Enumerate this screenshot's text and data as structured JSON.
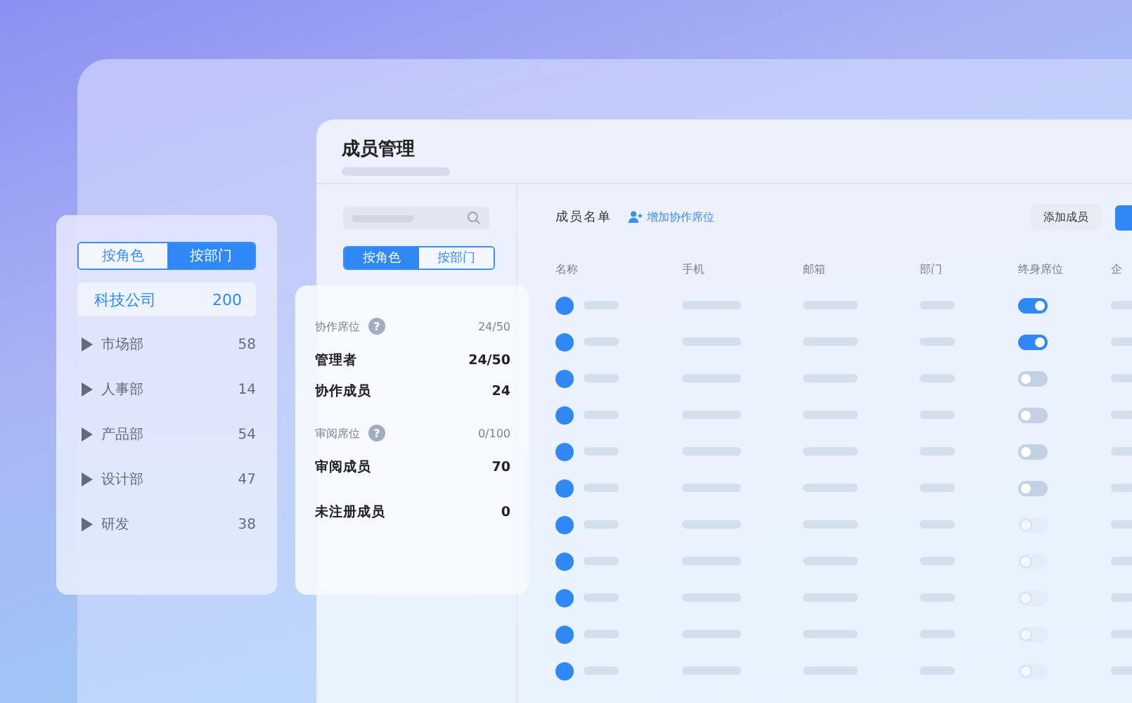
{
  "main": {
    "title": "成员管理",
    "sidebar_tabs": [
      {
        "label": "按角色",
        "selected": true
      },
      {
        "label": "按部门",
        "selected": false
      }
    ],
    "list_title": "成员名单",
    "add_seat_link": "增加协作席位",
    "add_member_button": "添加成员",
    "table": {
      "columns": [
        "名称",
        "手机",
        "邮箱",
        "部门",
        "终身席位",
        "企"
      ],
      "rows": [
        {
          "on": true,
          "disabled": false
        },
        {
          "on": true,
          "disabled": false
        },
        {
          "on": false,
          "disabled": false
        },
        {
          "on": false,
          "disabled": false
        },
        {
          "on": false,
          "disabled": false
        },
        {
          "on": false,
          "disabled": false
        },
        {
          "on": false,
          "disabled": true
        },
        {
          "on": false,
          "disabled": true
        },
        {
          "on": false,
          "disabled": true
        },
        {
          "on": false,
          "disabled": true
        },
        {
          "on": false,
          "disabled": true
        }
      ]
    }
  },
  "dept_card": {
    "tabs": [
      {
        "label": "按角色",
        "selected": false
      },
      {
        "label": "按部门",
        "selected": true
      }
    ],
    "company": {
      "name": "科技公司",
      "count": "200"
    },
    "items": [
      {
        "name": "市场部",
        "count": "58",
        "expanded": false
      },
      {
        "name": "人事部",
        "count": "14",
        "expanded": false
      },
      {
        "name": "产品部",
        "count": "54",
        "expanded": false
      },
      {
        "name": "设计部",
        "count": "47",
        "expanded": false
      },
      {
        "name": "研发",
        "count": "38",
        "expanded": false
      }
    ]
  },
  "seat_card": {
    "groups": [
      {
        "title": "协作席位",
        "help": "?",
        "value": "24/50",
        "rows": [
          {
            "label": "管理者",
            "value": "24/50"
          },
          {
            "label": "协作成员",
            "value": "24"
          }
        ]
      },
      {
        "title": "审阅席位",
        "help": "?",
        "value": "0/100",
        "rows": [
          {
            "label": "审阅成员",
            "value": "70"
          }
        ]
      },
      {
        "rows": [
          {
            "label": "未注册成员",
            "value": "0"
          }
        ]
      }
    ]
  }
}
